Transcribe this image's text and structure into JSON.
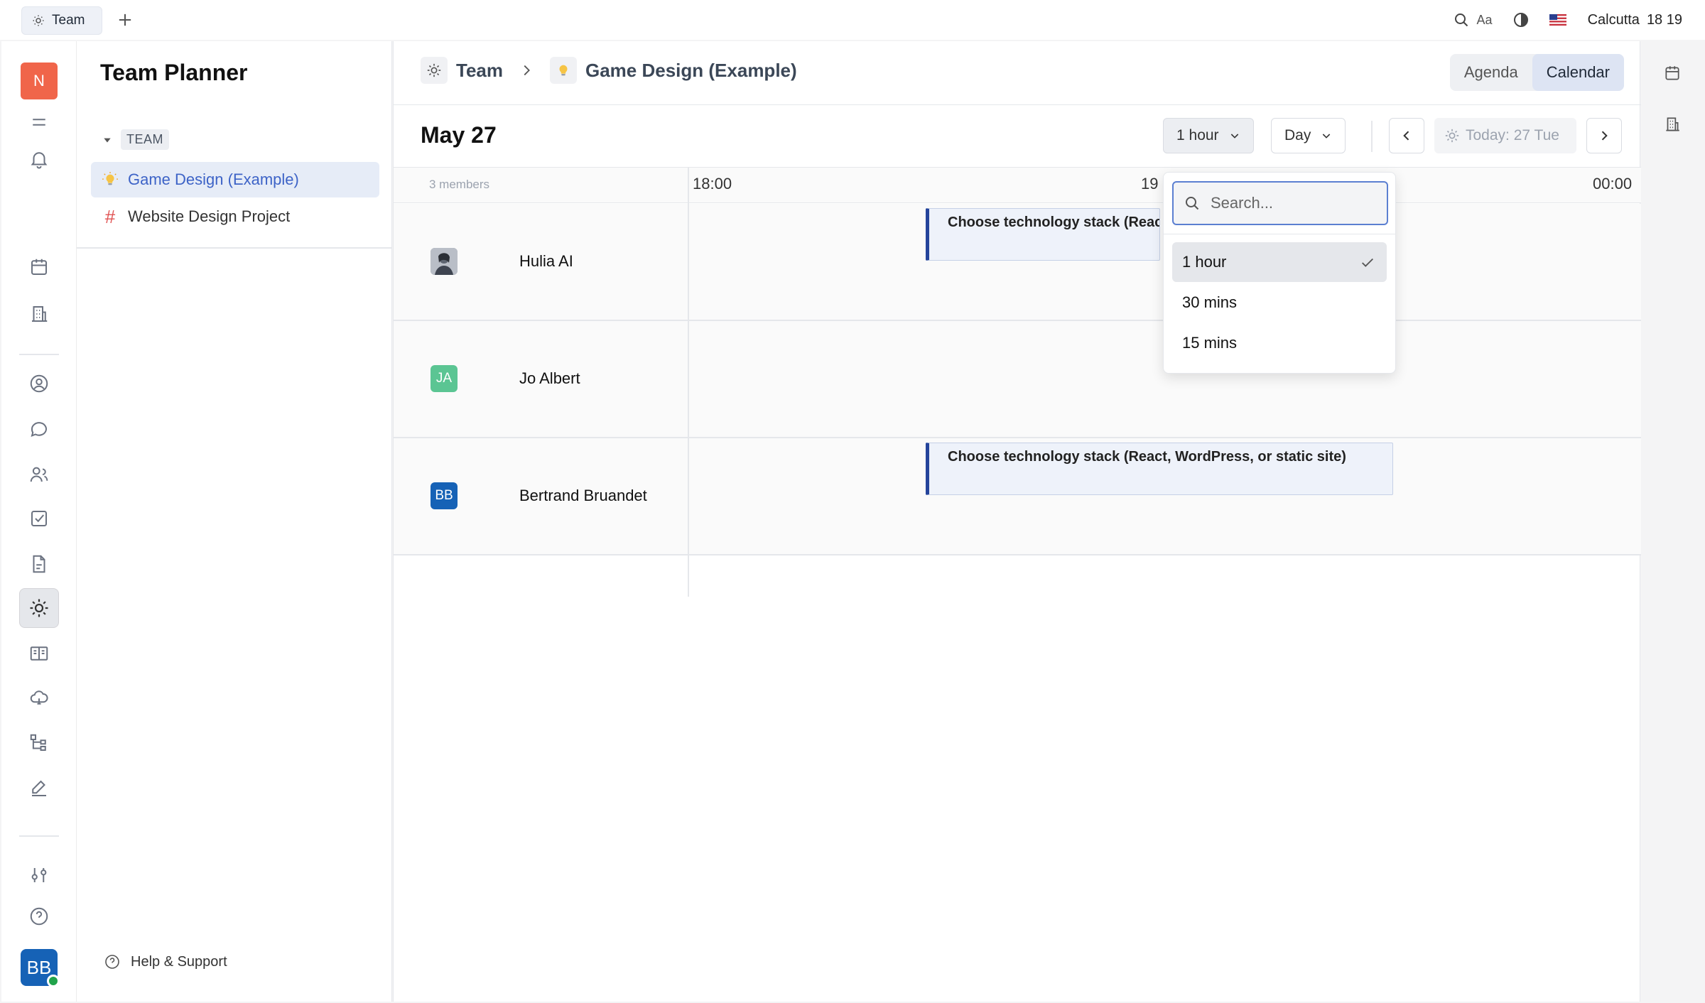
{
  "topbar": {
    "tab_label": "Team",
    "font_label": "Aa",
    "city": "Calcutta",
    "time": "18 19"
  },
  "rail": {
    "workspace_initial": "N",
    "user_initials": "BB",
    "active_item": "team-planner"
  },
  "nav": {
    "title": "Team Planner",
    "section_label": "TEAM",
    "items": [
      {
        "label": "Game Design (Example)",
        "selected": true
      },
      {
        "label": "Website Design Project",
        "selected": false
      }
    ],
    "help_label": "Help & Support"
  },
  "breadcrumb": {
    "root": "Team",
    "current": "Game Design (Example)"
  },
  "views": {
    "agenda": "Agenda",
    "calendar": "Calendar",
    "active": "Calendar"
  },
  "toolbar": {
    "date": "May 27",
    "interval": "1 hour",
    "range": "Day",
    "today": "Today: 27 Tue"
  },
  "grid": {
    "members_count": "3 members",
    "hours": [
      "18:00",
      "19",
      "00:00"
    ],
    "members": [
      {
        "name": "Hulia AI",
        "initials": "",
        "color": "#8a8f99"
      },
      {
        "name": "Jo Albert",
        "initials": "JA",
        "color": "#5bc593"
      },
      {
        "name": "Bertrand Bruandet",
        "initials": "BB",
        "color": "#1662b6"
      }
    ],
    "events": [
      {
        "member": "Hulia AI",
        "title": "Choose technology stack (React"
      },
      {
        "member": "Bertrand Bruandet",
        "title": "Choose technology stack (React, WordPress, or static site)"
      }
    ]
  },
  "dropdown": {
    "search_placeholder": "Search...",
    "options": [
      {
        "label": "1 hour",
        "selected": true
      },
      {
        "label": "30 mins",
        "selected": false
      },
      {
        "label": "15 mins",
        "selected": false
      }
    ]
  },
  "colors": {
    "accent": "#3d63c7",
    "event_border": "#24449b",
    "workspace_badge": "#f0654a",
    "user_avatar": "#1662b6",
    "online": "#21a34b"
  }
}
